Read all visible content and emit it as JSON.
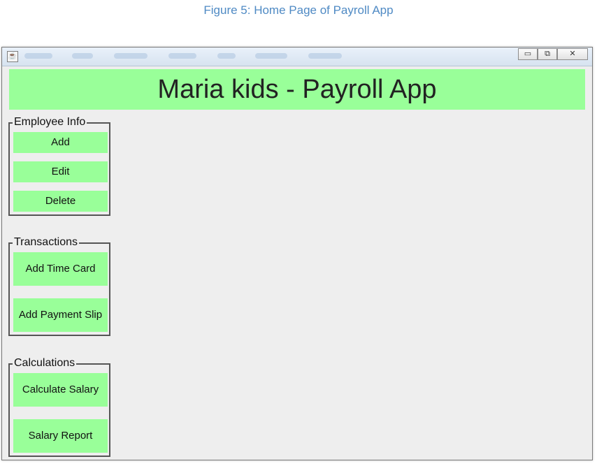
{
  "caption": "Figure 5: Home Page of Payroll App",
  "window": {
    "title_icon": "java-cup-icon",
    "controls": {
      "minimize": "▭",
      "maximize": "⧉",
      "close": "✕"
    }
  },
  "header": {
    "title": "Maria kids - Payroll App"
  },
  "groups": {
    "employee": {
      "title": "Employee Info",
      "add": "Add",
      "edit": "Edit",
      "delete": "Delete"
    },
    "transactions": {
      "title": "Transactions",
      "time_card": "Add Time Card",
      "payment_slip": "Add Payment Slip"
    },
    "calculations": {
      "title": "Calculations",
      "calc_salary": "Calculate Salary",
      "salary_report": "Salary Report"
    }
  },
  "colors": {
    "button_green": "#99ff99",
    "caption_blue": "#4f8ac4",
    "panel_bg": "#eeeeee"
  }
}
